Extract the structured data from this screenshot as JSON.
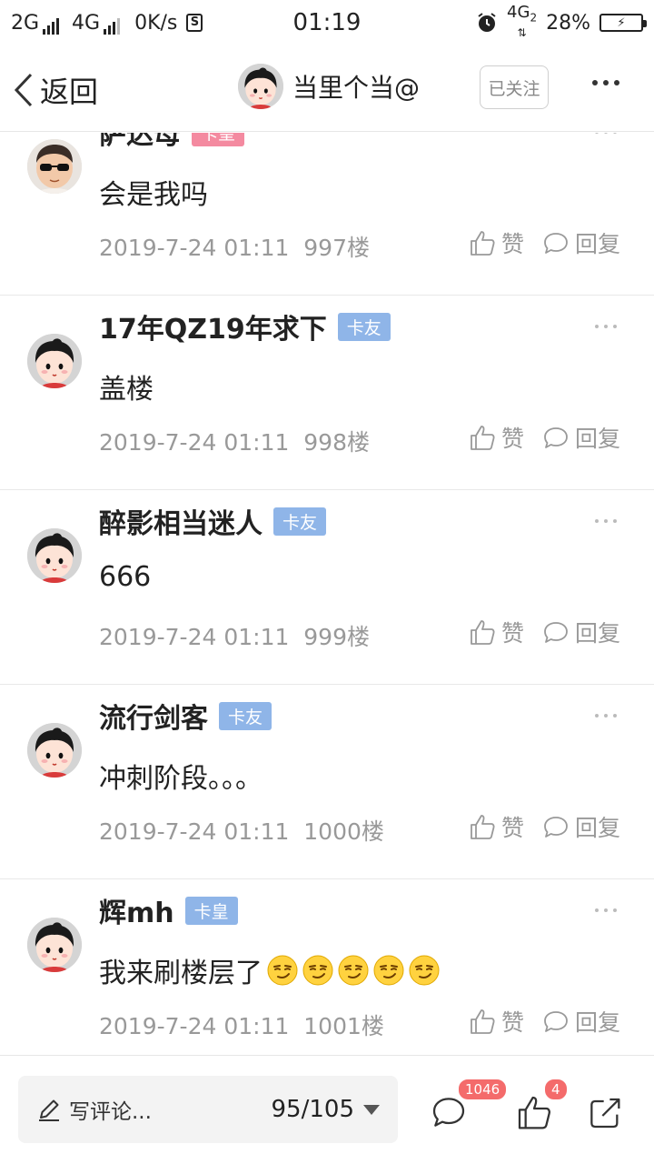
{
  "status_bar": {
    "net1": "2G",
    "net2": "4G",
    "speed": "0K/s",
    "s_icon": "S",
    "time": "01:19",
    "net3": "4G",
    "net3_sub": "2",
    "battery": "28%"
  },
  "nav": {
    "back_label": "返回",
    "title": "当里个当@",
    "follow_label": "已关注"
  },
  "posts": [
    {
      "username": "萨达母",
      "badge": "卡皇",
      "badge_color": "#f48aa0",
      "content": "会是我吗",
      "timestamp": "2019-7-24 01:11",
      "floor": "997楼",
      "like_label": "赞",
      "reply_label": "回复",
      "avatar_kind": "boy-sunglasses"
    },
    {
      "username": "17年QZ19年求下",
      "badge": "卡友",
      "badge_color": "#8fb5e8",
      "content": "盖楼",
      "timestamp": "2019-7-24 01:11",
      "floor": "998楼",
      "like_label": "赞",
      "reply_label": "回复",
      "avatar_kind": "cartoon-girl"
    },
    {
      "username": "醉影相当迷人",
      "badge": "卡友",
      "badge_color": "#8fb5e8",
      "content": "666",
      "timestamp": "2019-7-24 01:11",
      "floor": "999楼",
      "like_label": "赞",
      "reply_label": "回复",
      "avatar_kind": "cartoon-girl"
    },
    {
      "username": "流行剑客",
      "badge": "卡友",
      "badge_color": "#8fb5e8",
      "content": "冲刺阶段。。。",
      "timestamp": "2019-7-24 01:11",
      "floor": "1000楼",
      "like_label": "赞",
      "reply_label": "回复",
      "avatar_kind": "cartoon-girl"
    },
    {
      "username": "辉mh",
      "badge": "卡皇",
      "badge_color": "#8fb5e8",
      "content": "我来刷楼层了",
      "emoji_icons": [
        "smirk-emoji-icon",
        "smirk-emoji-icon",
        "smirk-emoji-icon",
        "smirk-emoji-icon",
        "smirk-emoji-icon"
      ],
      "timestamp": "2019-7-24 01:11",
      "floor": "1001楼",
      "like_label": "赞",
      "reply_label": "回复",
      "avatar_kind": "cartoon-girl"
    }
  ],
  "bottom_bar": {
    "comment_placeholder": "写评论...",
    "page_indicator": "95/105",
    "comment_count": "1046",
    "like_count": "4"
  },
  "colors": {
    "badge_pink": "#f48aa0",
    "badge_blue": "#8fb5e8",
    "count_badge": "#f46b6b",
    "meta_gray": "#999999"
  }
}
